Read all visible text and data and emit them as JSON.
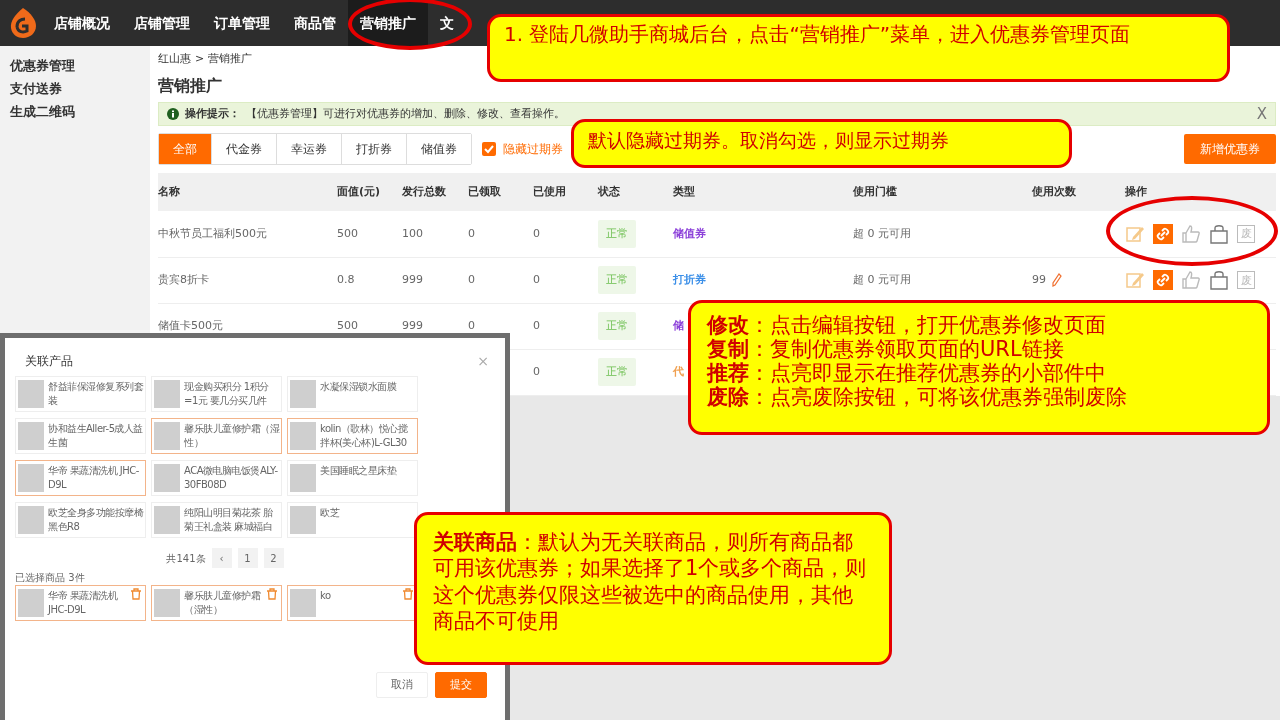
{
  "nav": {
    "items": [
      {
        "label": "店铺概况",
        "selected": false
      },
      {
        "label": "店铺管理",
        "selected": false
      },
      {
        "label": "订单管理",
        "selected": false
      },
      {
        "label": "商品管",
        "selected": false
      },
      {
        "label": "营销推广",
        "selected": true
      },
      {
        "label": "文",
        "selected": false
      }
    ]
  },
  "sidebar": {
    "items": [
      "优惠券管理",
      "支付送券",
      "生成二维码"
    ]
  },
  "breadcrumb": {
    "items": [
      "红山惠",
      "营销推广"
    ],
    "separator": ">"
  },
  "page_title": "营销推广",
  "alert": {
    "label": "操作提示：",
    "text": "【优惠券管理】可进行对优惠券的增加、删除、修改、查看操作。",
    "close": "X"
  },
  "filter_tabs": [
    {
      "label": "全部",
      "selected": true
    },
    {
      "label": "代金券",
      "selected": false
    },
    {
      "label": "幸运券",
      "selected": false
    },
    {
      "label": "打折券",
      "selected": false
    },
    {
      "label": "储值券",
      "selected": false
    }
  ],
  "hide_expired": {
    "label": "隐藏过期券",
    "checked": true
  },
  "add_button": "新增优惠券",
  "table": {
    "columns": [
      "名称",
      "面值(元)",
      "发行总数",
      "已领取",
      "已使用",
      "状态",
      "类型",
      "使用门槛",
      "使用次数",
      "操作"
    ],
    "rows": [
      {
        "name": "中秋节员工福利500元",
        "face_value": "500",
        "issued": "100",
        "received": "0",
        "used": "0",
        "status": "正常",
        "type": {
          "text": "储值券",
          "color": "#8b3fd9"
        },
        "threshold": "超 0 元可用",
        "actions": [
          {
            "kind": "edit",
            "on": false
          },
          {
            "kind": "link",
            "on": true
          },
          {
            "kind": "like",
            "on": false
          },
          {
            "kind": "bag",
            "on": false
          },
          {
            "kind": "void",
            "label": "废",
            "on": false
          }
        ]
      },
      {
        "name": "贵宾8折卡",
        "face_value": "0.8",
        "issued": "999",
        "received": "0",
        "used": "0",
        "status": "正常",
        "type": {
          "text": "打折券",
          "color": "#3b8fe8"
        },
        "threshold": "超 0 元可用",
        "usage_count": "99",
        "actions": [
          {
            "kind": "edit",
            "on": false
          },
          {
            "kind": "link",
            "on": true
          },
          {
            "kind": "like",
            "on": false
          },
          {
            "kind": "bag",
            "on": false
          },
          {
            "kind": "void",
            "label": "废",
            "on": false
          }
        ]
      },
      {
        "name": "储值卡500元",
        "face_value": "500",
        "issued": "999",
        "received": "0",
        "used": "0",
        "status": "正常",
        "type": {
          "text": "储",
          "color": "#8b3fd9"
        }
      },
      {
        "used": "0",
        "status": "正常",
        "type": {
          "text": "代",
          "color": "#f0a050"
        }
      }
    ]
  },
  "dialog": {
    "title": "关联产品",
    "close": "×",
    "products": [
      {
        "name": "舒益菲保湿修复系列套装",
        "selected": false
      },
      {
        "name": "现金购买积分 1积分=1元 要几分买几件",
        "selected": false
      },
      {
        "name": "水凝保湿锁水面膜",
        "selected": false
      },
      {
        "name": "协和益生Aller-5成人益生菌",
        "selected": false
      },
      {
        "name": "馨乐肤儿童修护霜（湿性）",
        "selected": true
      },
      {
        "name": "kolin（歌林）悦心搅拌杯(美心杯)L-GL30",
        "selected": true
      },
      {
        "name": "华帝 果蔬清洗机 JHC-D9L",
        "selected": true
      },
      {
        "name": "ACA微电脑电饭煲ALY-30FB08D",
        "selected": false
      },
      {
        "name": "美国睡眠之星床垫",
        "selected": false
      },
      {
        "name": "欧芝全身多功能按摩椅黑色R8",
        "selected": false
      },
      {
        "name": "纯阳山明目菊花茶 胎菊王礼盒装 麻城福白",
        "selected": false
      },
      {
        "name": "欧芝",
        "selected": false
      }
    ],
    "pagination": {
      "total": "共141条",
      "prev": "‹",
      "pages": [
        "1",
        "2"
      ]
    },
    "selected_label": "已选择商品 3件",
    "selected_items": [
      {
        "name": "华帝 果蔬清洗机 JHC-D9L"
      },
      {
        "name": "馨乐肤儿童修护霜（湿性）"
      },
      {
        "name": "ko"
      }
    ],
    "buttons": [
      {
        "label": "取消",
        "kind": "secondary"
      },
      {
        "label": "提交",
        "kind": "primary"
      }
    ]
  },
  "callouts": [
    {
      "lines": [
        "1. 登陆几微助手商城后台，点击“营销推广”菜单，进入优惠券管理页面"
      ]
    },
    {
      "lines": [
        "默认隐藏过期券。取消勾选，则显示过期券"
      ]
    },
    {
      "lines": [
        "**修改**：点击编辑按钮，打开优惠券修改页面",
        "**复制**：复制优惠券领取页面的URL链接",
        "**推荐**：点亮即显示在推荐优惠券的小部件中",
        "**废除**：点亮废除按钮，可将该优惠券强制废除"
      ]
    },
    {
      "lines": [
        "**关联商品**：默认为无关联商品，则所有商品都可用该优惠券；如果选择了1个或多个商品，则这个优惠券仅限这些被选中的商品使用，其他商品不可使用"
      ]
    }
  ]
}
